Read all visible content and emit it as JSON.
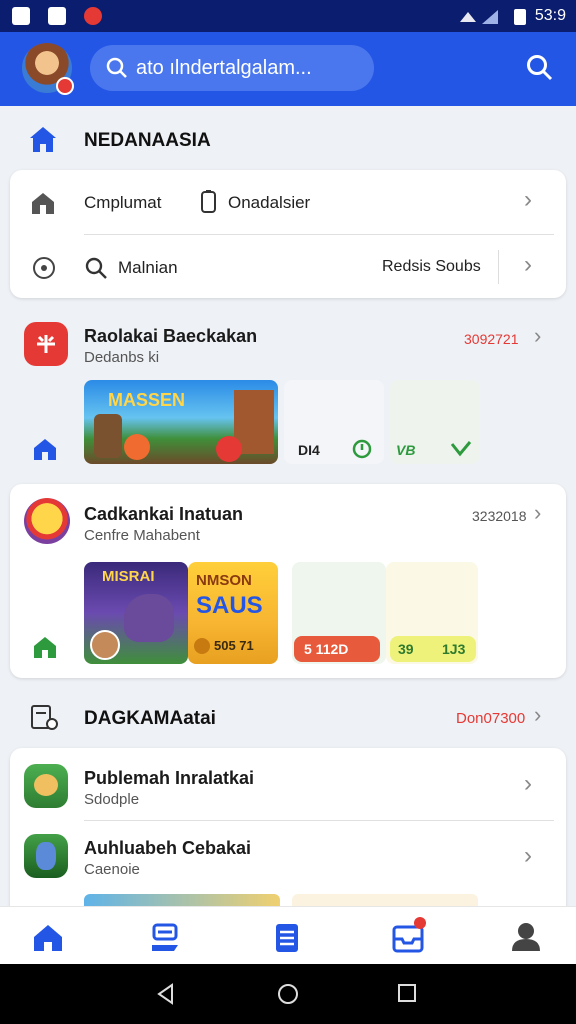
{
  "status_bar": {
    "time": "53:9"
  },
  "header": {
    "search_value": "ato ılndertalgalam..."
  },
  "home_section": {
    "title": "NEDANAASIA"
  },
  "quick_card": {
    "row1": {
      "left_label": "Cmplumat",
      "right_label": "Onadalsier"
    },
    "row2": {
      "left_label": "Malnian",
      "right_label": "Redsis Soubs"
    }
  },
  "app1": {
    "title": "Raolakai Baeckakan",
    "subtitle": "Dedanbs ki",
    "count": "3092721",
    "thumb_text": "MASSEN",
    "stats": [
      "DI4",
      "VB"
    ]
  },
  "app2": {
    "title": "Cadkankai Inatuan",
    "subtitle": "Cenfre Mahabent",
    "count": "3232018",
    "thumb1_text": "MISRAI",
    "thumb2_line1": "NMSON",
    "thumb2_line2": "SAUS",
    "thumb2_price": "505 71",
    "pill1": "5 112D",
    "pill2_left": "39",
    "pill2_right": "1J3"
  },
  "section2": {
    "title": "DAGKAMAatai",
    "count": "Don07300"
  },
  "list": [
    {
      "title": "Publemah Inralatkai",
      "subtitle": "Sdodple"
    },
    {
      "title": "Auhluabeh Cebakai",
      "subtitle": "Caenoie"
    }
  ],
  "colors": {
    "brand": "#2456e6",
    "accent_red": "#e53935",
    "accent_green": "#2e9a3e"
  }
}
